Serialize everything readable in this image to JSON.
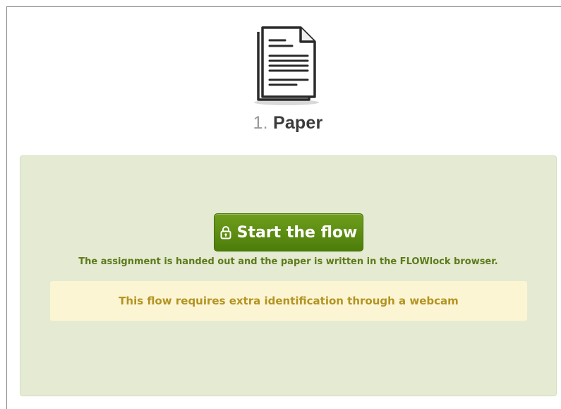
{
  "step": {
    "number": "1.",
    "name": "Paper",
    "icon": "document-icon"
  },
  "action": {
    "button_label": "Start the flow",
    "button_icon": "lock-icon",
    "description": "The assignment is handed out and the paper is written in the FLOWlock browser."
  },
  "notice": {
    "text": "This flow requires extra identification through a webcam"
  },
  "colors": {
    "panel_bg": "#e4ebd2",
    "button_green": "#5a8c12",
    "description_text": "#5d7a1c",
    "notice_bg": "#fbf5d4",
    "notice_text": "#b39321"
  }
}
